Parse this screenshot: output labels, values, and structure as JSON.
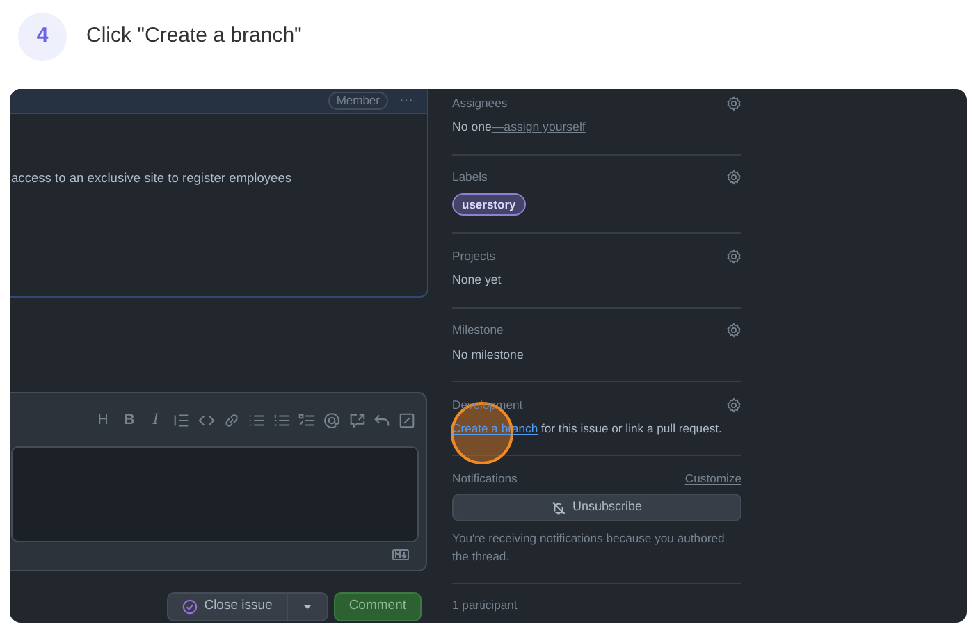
{
  "step": {
    "number": "4",
    "title": "Click \"Create a branch\""
  },
  "comment": {
    "badge": "Member",
    "menu": "···",
    "body": "access to an exclusive site to register employees"
  },
  "toolbar": [
    {
      "kind": "text",
      "label": "H"
    },
    {
      "kind": "text",
      "label": "B"
    },
    {
      "kind": "italic",
      "label": "I"
    },
    {
      "kind": "quote"
    },
    {
      "kind": "code"
    },
    {
      "kind": "link"
    },
    {
      "kind": "bullets"
    },
    {
      "kind": "numbers"
    },
    {
      "kind": "tasks"
    },
    {
      "kind": "mention"
    },
    {
      "kind": "reference"
    },
    {
      "kind": "undo"
    },
    {
      "kind": "fullscreen"
    }
  ],
  "actions": {
    "close": "Close issue",
    "comment": "Comment"
  },
  "sidebar": [
    {
      "heading": "Assignees",
      "value": "No one",
      "link": "—assign yourself"
    },
    {
      "heading": "Labels",
      "labels": [
        {
          "name": "userstory",
          "color": "#8a82d6"
        }
      ]
    },
    {
      "heading": "Projects",
      "value": "None yet"
    },
    {
      "heading": "Milestone",
      "value": "No milestone"
    },
    {
      "heading": "Development",
      "link": "Create a branch",
      "value": " for this issue or link a pull request.",
      "clicked": true
    }
  ],
  "notifications": {
    "heading": "Notifications",
    "customize": "Customize",
    "button": "Unsubscribe",
    "note": "You're receiving notifications because you authored the thread."
  },
  "participants": "1 participant"
}
